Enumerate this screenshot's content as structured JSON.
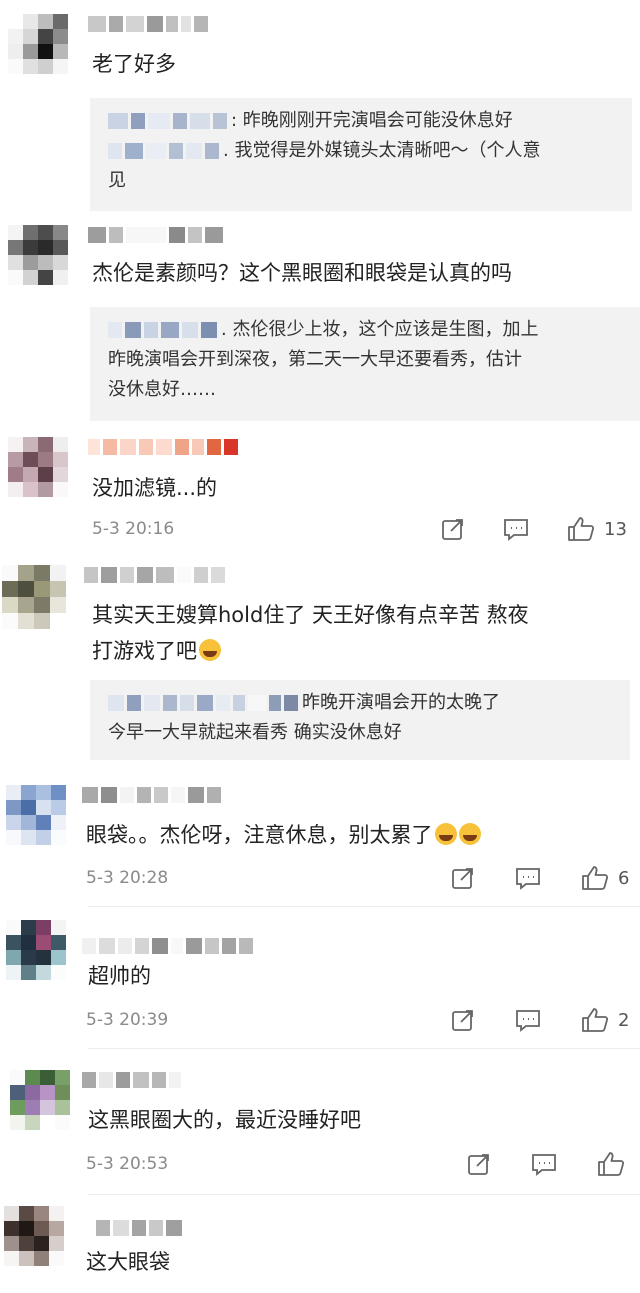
{
  "comments": [
    {
      "text": "老了好多",
      "replies": [
        {
          "text": ": 昨晚刚刚开完演唱会可能没休息好"
        },
        {
          "text": ". 我觉得是外媒镜头太清晰吧～（个人意",
          "text2": "见"
        }
      ]
    },
    {
      "text": "杰伦是素颜吗？这个黑眼圈和眼袋是认真的吗",
      "replies": [
        {
          "text": ". 杰伦很少上妆，这个应该是生图，加上",
          "text2": "昨晚演唱会开到深夜，第二天一大早还要看秀，估计",
          "text3": "没休息好……"
        }
      ]
    },
    {
      "text": "没加滤镜...的",
      "time": "5-3 20:16",
      "likes": "13"
    },
    {
      "text": "其实天王嫂算hold住了 天王好像有点辛苦 熬夜",
      "text2": "打游戏了吧",
      "replies": [
        {
          "text": "昨晚开演唱会开的太晚了",
          "text2": "今早一大早就起来看秀 确实没休息好"
        }
      ]
    },
    {
      "text": "眼袋。。杰伦呀，注意休息，别太累了",
      "time": "5-3 20:28",
      "likes": "6"
    },
    {
      "text": "超帅的",
      "time": "5-3 20:39",
      "likes": "2"
    },
    {
      "text": "这黑眼圈大的，最近没睡好吧",
      "time": "5-3 20:53",
      "likes": ""
    },
    {
      "text": "这大眼袋"
    }
  ],
  "icons": {
    "share": "share-icon",
    "comment": "comment-icon",
    "like": "like-icon",
    "emoji_grin": "grin-emoji-icon",
    "emoji_cry": "crying-emoji-icon"
  },
  "colors": {
    "text": "#222222",
    "meta": "#8a8a8a",
    "reply_bg": "#f2f2f2"
  }
}
